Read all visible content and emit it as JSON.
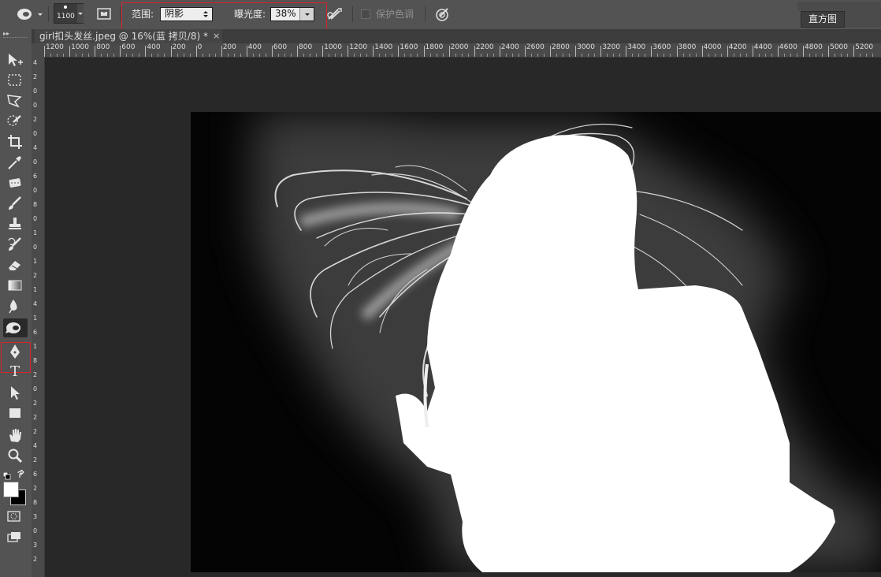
{
  "options_bar": {
    "brush_size": "1100",
    "range_label": "范围:",
    "range_value": "阴影",
    "exposure_label": "曝光度:",
    "exposure_value": "38%",
    "protect_tones_label": "保护色调",
    "protect_tones_checked": false
  },
  "panel": {
    "histogram_tab": "直方图"
  },
  "document": {
    "tab_title": "girl扣头发丝.jpeg @ 16%(蓝 拷贝/8) *",
    "close_symbol": "×"
  },
  "ruler": {
    "h_ticks": [
      "1200",
      "1000",
      "800",
      "600",
      "400",
      "200",
      "0",
      "200",
      "400",
      "600",
      "800",
      "1000",
      "1200",
      "1400",
      "1600",
      "1800",
      "2000",
      "2200",
      "2400",
      "2600",
      "2800",
      "3000",
      "3200",
      "3400",
      "3600",
      "3800",
      "4000",
      "4200",
      "4400",
      "4600",
      "4800",
      "5000",
      "5200"
    ],
    "v_ticks": [
      "4",
      "2",
      "0",
      "0",
      "2",
      "0",
      "4",
      "0",
      "6",
      "0",
      "8",
      "0",
      "1",
      "0",
      "1",
      "2",
      "1",
      "4",
      "1",
      "6",
      "1",
      "8",
      "2",
      "0",
      "2",
      "2",
      "2",
      "4",
      "2",
      "6",
      "2",
      "8",
      "3",
      "0",
      "3",
      "2"
    ]
  },
  "tools": [
    {
      "name": "move-tool",
      "icon": "move-icon"
    },
    {
      "name": "marquee-tool",
      "icon": "marquee-icon"
    },
    {
      "name": "lasso-tool",
      "icon": "lasso-icon"
    },
    {
      "name": "quick-select-tool",
      "icon": "quick-select-icon"
    },
    {
      "name": "crop-tool",
      "icon": "crop-icon"
    },
    {
      "name": "eyedropper-tool",
      "icon": "eyedropper-icon"
    },
    {
      "name": "healing-brush-tool",
      "icon": "healing-icon"
    },
    {
      "name": "brush-tool",
      "icon": "brush-icon"
    },
    {
      "name": "clone-stamp-tool",
      "icon": "stamp-icon"
    },
    {
      "name": "history-brush-tool",
      "icon": "history-brush-icon"
    },
    {
      "name": "eraser-tool",
      "icon": "eraser-icon"
    },
    {
      "name": "gradient-tool",
      "icon": "gradient-icon"
    },
    {
      "name": "blur-tool",
      "icon": "blur-icon"
    },
    {
      "name": "burn-tool",
      "icon": "burn-icon",
      "active": true
    },
    {
      "name": "pen-tool",
      "icon": "pen-icon"
    },
    {
      "name": "type-tool",
      "icon": "type-icon"
    },
    {
      "name": "path-select-tool",
      "icon": "path-select-icon"
    },
    {
      "name": "rectangle-tool",
      "icon": "rectangle-icon"
    },
    {
      "name": "hand-tool",
      "icon": "hand-icon"
    },
    {
      "name": "zoom-tool",
      "icon": "zoom-icon"
    }
  ],
  "type_tool_glyph": "T",
  "colors": {
    "highlight_red": "#d8232a",
    "foreground": "#ffffff",
    "background": "#000000"
  }
}
